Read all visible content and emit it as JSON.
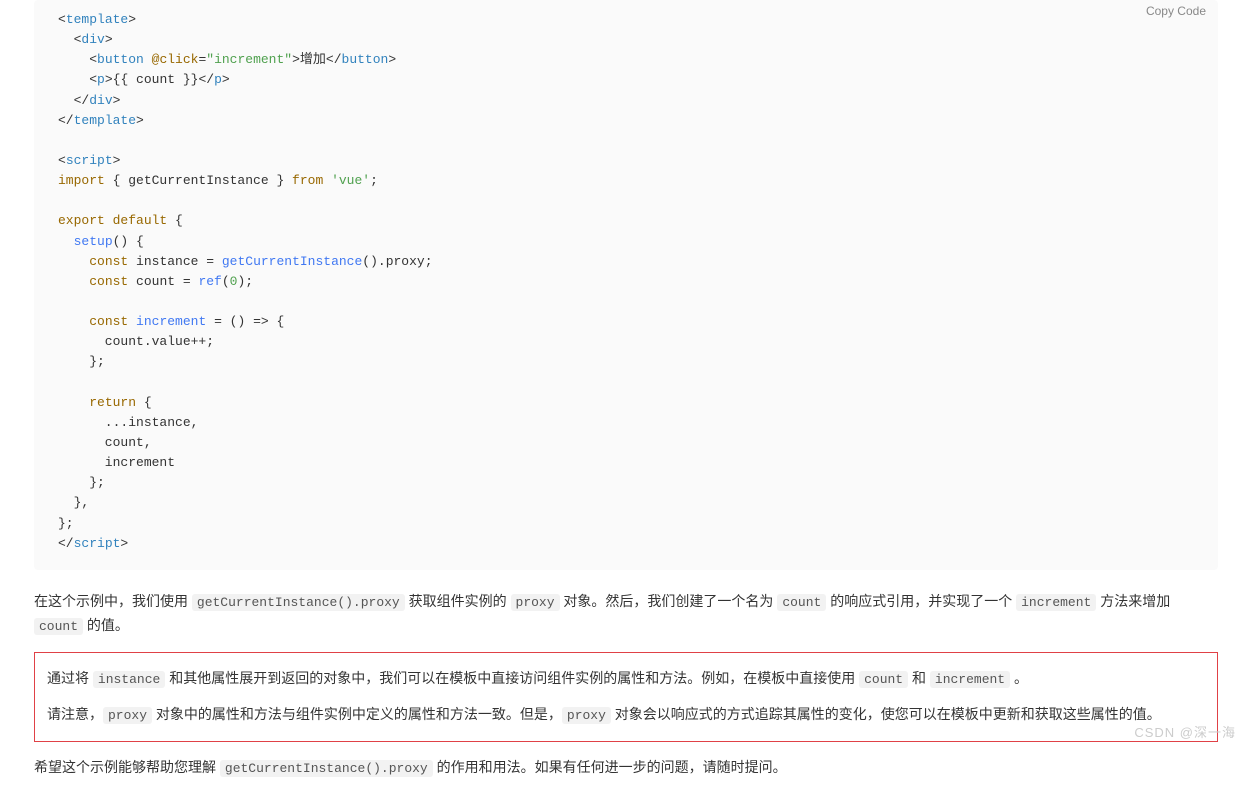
{
  "copy_label": "Copy Code",
  "code": {
    "line1_tag": "template",
    "line2_tag": "div",
    "line3_tag_open": "button",
    "line3_attr": "@click",
    "line3_val": "\"increment\"",
    "line3_text": "增加",
    "line3_tag_close": "button",
    "line4_tag": "p",
    "line4_content": "{{ count }}",
    "line5_close": "div",
    "line6_close": "template",
    "line8_tag": "script",
    "line9_kw_import": "import",
    "line9_braces": " { getCurrentInstance } ",
    "line9_kw_from": "from",
    "line9_mod": "'vue'",
    "line11_kw_export": "export",
    "line11_kw_default": "default",
    "line12_func": "setup",
    "line13_kw": "const",
    "line13_var": " instance = ",
    "line13_func": "getCurrentInstance",
    "line13_tail": "().proxy;",
    "line14_kw": "const",
    "line14_var": " count = ",
    "line14_func": "ref",
    "line14_num": "0",
    "line16_kw": "const",
    "line16_name": "increment",
    "line16_arrow": " = () => {",
    "line17": "      count.value++;",
    "line18": "    };",
    "line20_kw": "return",
    "line21": "      ...instance,",
    "line22": "      count,",
    "line23": "      increment",
    "line24": "    };",
    "line25": "  },",
    "line26": "};",
    "line27_close": "script"
  },
  "para1": {
    "t1": "在这个示例中，我们使用 ",
    "c1": "getCurrentInstance().proxy",
    "t2": " 获取组件实例的 ",
    "c2": "proxy",
    "t3": " 对象。然后，我们创建了一个名为 ",
    "c3": "count",
    "t4": " 的响应式引用，并实现了一个 ",
    "c4": "increment",
    "t5": " 方法来增加 ",
    "c5": "count",
    "t6": " 的值。"
  },
  "para2": {
    "t1": "通过将 ",
    "c1": "instance",
    "t2": " 和其他属性展开到返回的对象中，我们可以在模板中直接访问组件实例的属性和方法。例如，在模板中直接使用 ",
    "c2": "count",
    "t3": " 和 ",
    "c3": "increment",
    "t4": " 。"
  },
  "para3": {
    "t1": "请注意，",
    "c1": "proxy",
    "t2": " 对象中的属性和方法与组件实例中定义的属性和方法一致。但是，",
    "c2": "proxy",
    "t3": " 对象会以响应式的方式追踪其属性的变化，使您可以在模板中更新和获取这些属性的值。"
  },
  "para4": {
    "t1": "希望这个示例能够帮助您理解 ",
    "c1": "getCurrentInstance().proxy",
    "t2": " 的作用和用法。如果有任何进一步的问题，请随时提问。"
  },
  "watermark": "CSDN @深一海"
}
